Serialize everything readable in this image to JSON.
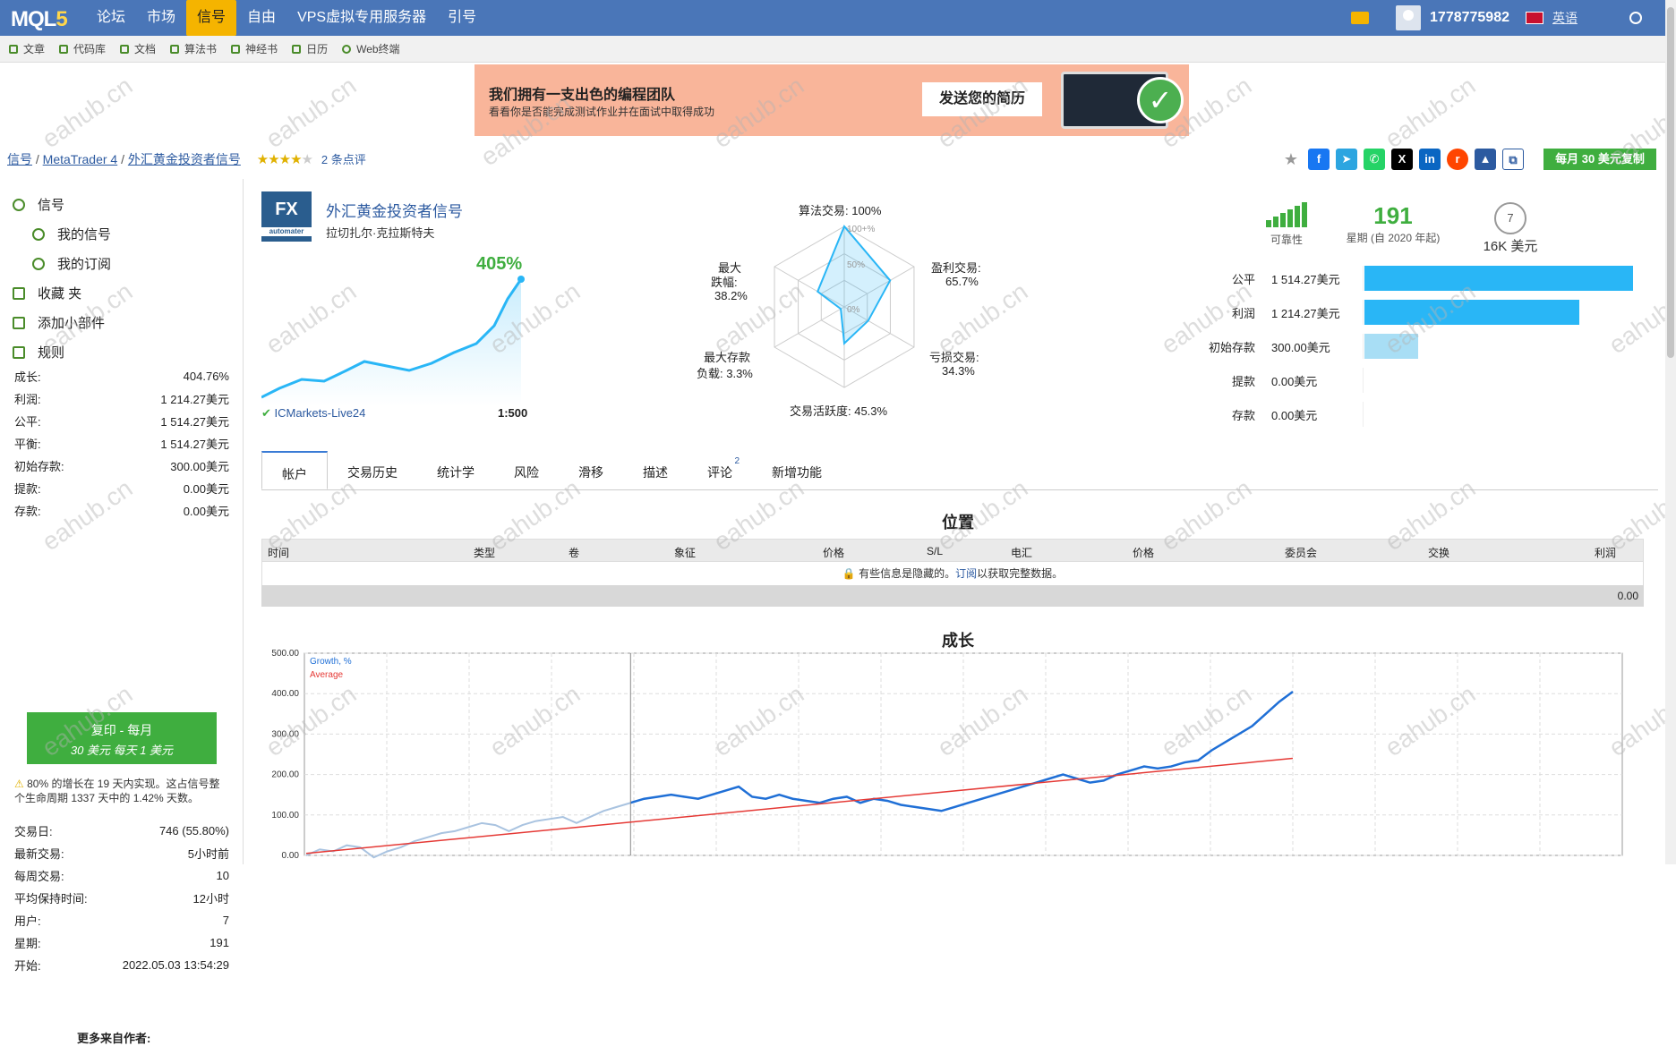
{
  "topbar": {
    "logo": "MQL",
    "logo_num": "5",
    "nav": [
      "论坛",
      "市场",
      "信号",
      "自由",
      "VPS虚拟专用服务器",
      "引号"
    ],
    "username": "1778775982",
    "language": "英语"
  },
  "subnav": [
    "文章",
    "代码库",
    "文档",
    "算法书",
    "神经书",
    "日历",
    "Web终端"
  ],
  "banner": {
    "title": "我们拥有一支出色的编程团队",
    "subtitle": "看看你是否能完成测试作业并在面试中取得成功",
    "button": "发送您的简历"
  },
  "breadcrumb": {
    "signals": "信号",
    "platform": "MetaTrader 4",
    "signal": "外汇黄金投资者信号",
    "reviews": "2 条点评"
  },
  "rating": {
    "stars_filled": 4,
    "stars_total": 5
  },
  "copy_button": "每月 30 美元复制",
  "sidebar": {
    "menu": [
      {
        "label": "信号",
        "sub": false
      },
      {
        "label": "我的信号",
        "sub": true
      },
      {
        "label": "我的订阅",
        "sub": true
      },
      {
        "label": "收藏 夹",
        "sub": false
      },
      {
        "label": "添加小部件",
        "sub": false
      },
      {
        "label": "规则",
        "sub": false
      }
    ],
    "stats1": [
      {
        "k": "成长:",
        "v": "404.76%"
      },
      {
        "k": "利润:",
        "v": "1 214.27美元"
      },
      {
        "k": "公平:",
        "v": "1 514.27美元"
      },
      {
        "k": "平衡:",
        "v": "1 514.27美元"
      },
      {
        "k": "初始存款:",
        "v": "300.00美元"
      },
      {
        "k": "提款:",
        "v": "0.00美元"
      },
      {
        "k": "存款:",
        "v": "0.00美元"
      }
    ],
    "follow_btn": {
      "line1": "复印 - 每月",
      "line2": "30 美元 每天 1 美元"
    },
    "note": "80% 的增长在 19 天内实现。这占信号整个生命周期 1337 天中的 1.42% 天数。",
    "stats2": [
      {
        "k": "交易日:",
        "v": "746 (55.80%)"
      },
      {
        "k": "最新交易:",
        "v": "5小时前"
      },
      {
        "k": "每周交易:",
        "v": "10"
      },
      {
        "k": "平均保持时间:",
        "v": "12小时"
      },
      {
        "k": "用户:",
        "v": "7"
      },
      {
        "k": "星期:",
        "v": "191"
      },
      {
        "k": "开始:",
        "v": "2022.05.03 13:54:29"
      }
    ],
    "more": "更多来自作者:"
  },
  "signal": {
    "logo_text": "FX",
    "logo_sub": "automater",
    "name": "外汇黄金投资者信号",
    "author": "拉切扎尔·克拉斯特夫",
    "growth": "405%",
    "broker": "ICMarkets-Live24",
    "leverage": "1:500"
  },
  "radar": {
    "algo": "算法交易:  100%",
    "profit": "盈利交易:",
    "profit_v": "65.7%",
    "loss": "亏损交易:",
    "loss_v": "34.3%",
    "activity": "交易活跃度:  45.3%",
    "maxload": "最大存款",
    "maxload2": "负载:  3.3%",
    "dd": "最大",
    "dd2": "跌幅:",
    "dd3": "38.2%",
    "ring100": "100+%",
    "ring50": "50%",
    "ring0": "0%",
    "values": {
      "algo": 1.0,
      "profit": 0.657,
      "loss": 0.343,
      "activity": 0.453,
      "load": 0.033,
      "drawdown": 0.382
    }
  },
  "summary": {
    "reliability": "可靠性",
    "weeks": "191",
    "weeks_label": "星期",
    "weeks_sub": "(自 2020 年起)",
    "subs": "7",
    "subs_money": "16K 美元"
  },
  "bars": [
    {
      "k": "公平",
      "v": "1 514.27美元",
      "frac": 1.0,
      "color": "#29b6f6"
    },
    {
      "k": "利润",
      "v": "1 214.27美元",
      "frac": 0.8,
      "color": "#29b6f6"
    },
    {
      "k": "初始存款",
      "v": "300.00美元",
      "frac": 0.2,
      "color": "#a8def5"
    },
    {
      "k": "提款",
      "v": "0.00美元",
      "frac": 0,
      "color": "#29b6f6"
    },
    {
      "k": "存款",
      "v": "0.00美元",
      "frac": 0,
      "color": "#29b6f6"
    }
  ],
  "tabs": [
    "帐户",
    "交易历史",
    "统计学",
    "风险",
    "滑移",
    "描述",
    "评论",
    "新增功能"
  ],
  "tab_badge": "2",
  "positions": {
    "title": "位置",
    "cols": [
      "时间",
      "类型",
      "卷",
      "象征",
      "价格",
      "S/L",
      "电汇",
      "价格",
      "委员会",
      "交换",
      "利润"
    ],
    "info_pre": "有些信息是隐藏的。",
    "info_link": "订阅",
    "info_post": "以获取完整数据。",
    "total": "0.00"
  },
  "growth_chart_title": "成长",
  "watermark": "eahub.cn",
  "chart_data": {
    "type": "line",
    "legend": [
      "Growth, %",
      "Average"
    ],
    "y_ticks": [
      "500.00",
      "400.00",
      "300.00",
      "200.00",
      "100.00",
      "0.00"
    ],
    "ylim": [
      0,
      500
    ],
    "series": [
      {
        "name": "Growth, %",
        "color": "#1f6fd6",
        "values": [
          0,
          15,
          10,
          25,
          20,
          -5,
          10,
          20,
          35,
          45,
          55,
          60,
          70,
          80,
          75,
          60,
          75,
          85,
          90,
          95,
          80,
          95,
          110,
          120,
          130,
          140,
          145,
          150,
          145,
          140,
          150,
          160,
          170,
          145,
          140,
          150,
          140,
          135,
          130,
          140,
          145,
          130,
          140,
          135,
          125,
          120,
          115,
          110,
          120,
          130,
          140,
          150,
          160,
          170,
          180,
          190,
          200,
          190,
          180,
          185,
          200,
          210,
          220,
          215,
          220,
          230,
          235,
          260,
          280,
          300,
          320,
          350,
          380,
          405
        ]
      },
      {
        "name": "Average",
        "color": "#e53935",
        "values": [
          5,
          240
        ]
      }
    ]
  }
}
